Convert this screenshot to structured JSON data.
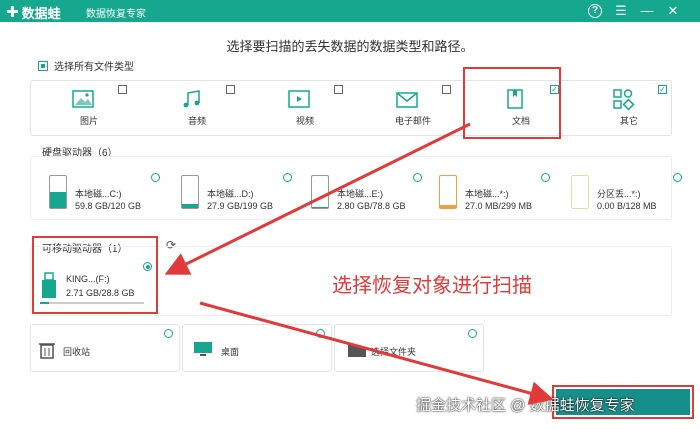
{
  "app": {
    "logo_text": "数据蛙",
    "subtitle": "数据恢复专家",
    "help": "?",
    "menu": "☰",
    "minimize": "—",
    "close": "✕"
  },
  "heading": "选择要扫描的丢失数据的数据类型和路径。",
  "select_all_label": "选择所有文件类型",
  "file_types": [
    {
      "label": "图片",
      "icon": "image-icon",
      "checked": false
    },
    {
      "label": "音频",
      "icon": "music-icon",
      "checked": false
    },
    {
      "label": "视频",
      "icon": "video-icon",
      "checked": false
    },
    {
      "label": "电子邮件",
      "icon": "email-icon",
      "checked": false
    },
    {
      "label": "文档",
      "icon": "document-icon",
      "checked": true,
      "mark": "✓"
    },
    {
      "label": "其它",
      "icon": "other-icon",
      "checked": true,
      "mark": "✓"
    }
  ],
  "hard_drives_label": "硬盘驱动器（6）",
  "hard_drives": [
    {
      "name": "本地磁...C:)",
      "size": "59.8 GB/120 GB",
      "used": 0.5
    },
    {
      "name": "本地磁...D:)",
      "size": "27.9 GB/199 GB",
      "used": 0.14
    },
    {
      "name": "本地磁...E:)",
      "size": "2.80 GB/78.8 GB",
      "used": 0.04
    },
    {
      "name": "本地磁...*:)",
      "size": "27.0 MB/299 MB",
      "used": 0.09
    },
    {
      "name": "分区丢...*:)",
      "size": "0.00  B/128 MB",
      "used": 0.0
    }
  ],
  "removable_label": "可移动驱动器（1）",
  "removable": {
    "name": "KING...(F:)",
    "size": "2.71 GB/28.8 GB",
    "used": 0.09
  },
  "annotation": "选择恢复对象进行扫描",
  "locations": [
    {
      "label": "回收站",
      "icon": "trash-icon"
    },
    {
      "label": "桌面",
      "icon": "desktop-icon"
    },
    {
      "label": "选择文件夹",
      "icon": "folder-icon"
    }
  ],
  "watermark": "掘金技术社区 @ 数据蛙恢复专家",
  "colors": {
    "brand": "#15a88e",
    "highlight": "#e23a3a",
    "cta": "#168f8a"
  }
}
